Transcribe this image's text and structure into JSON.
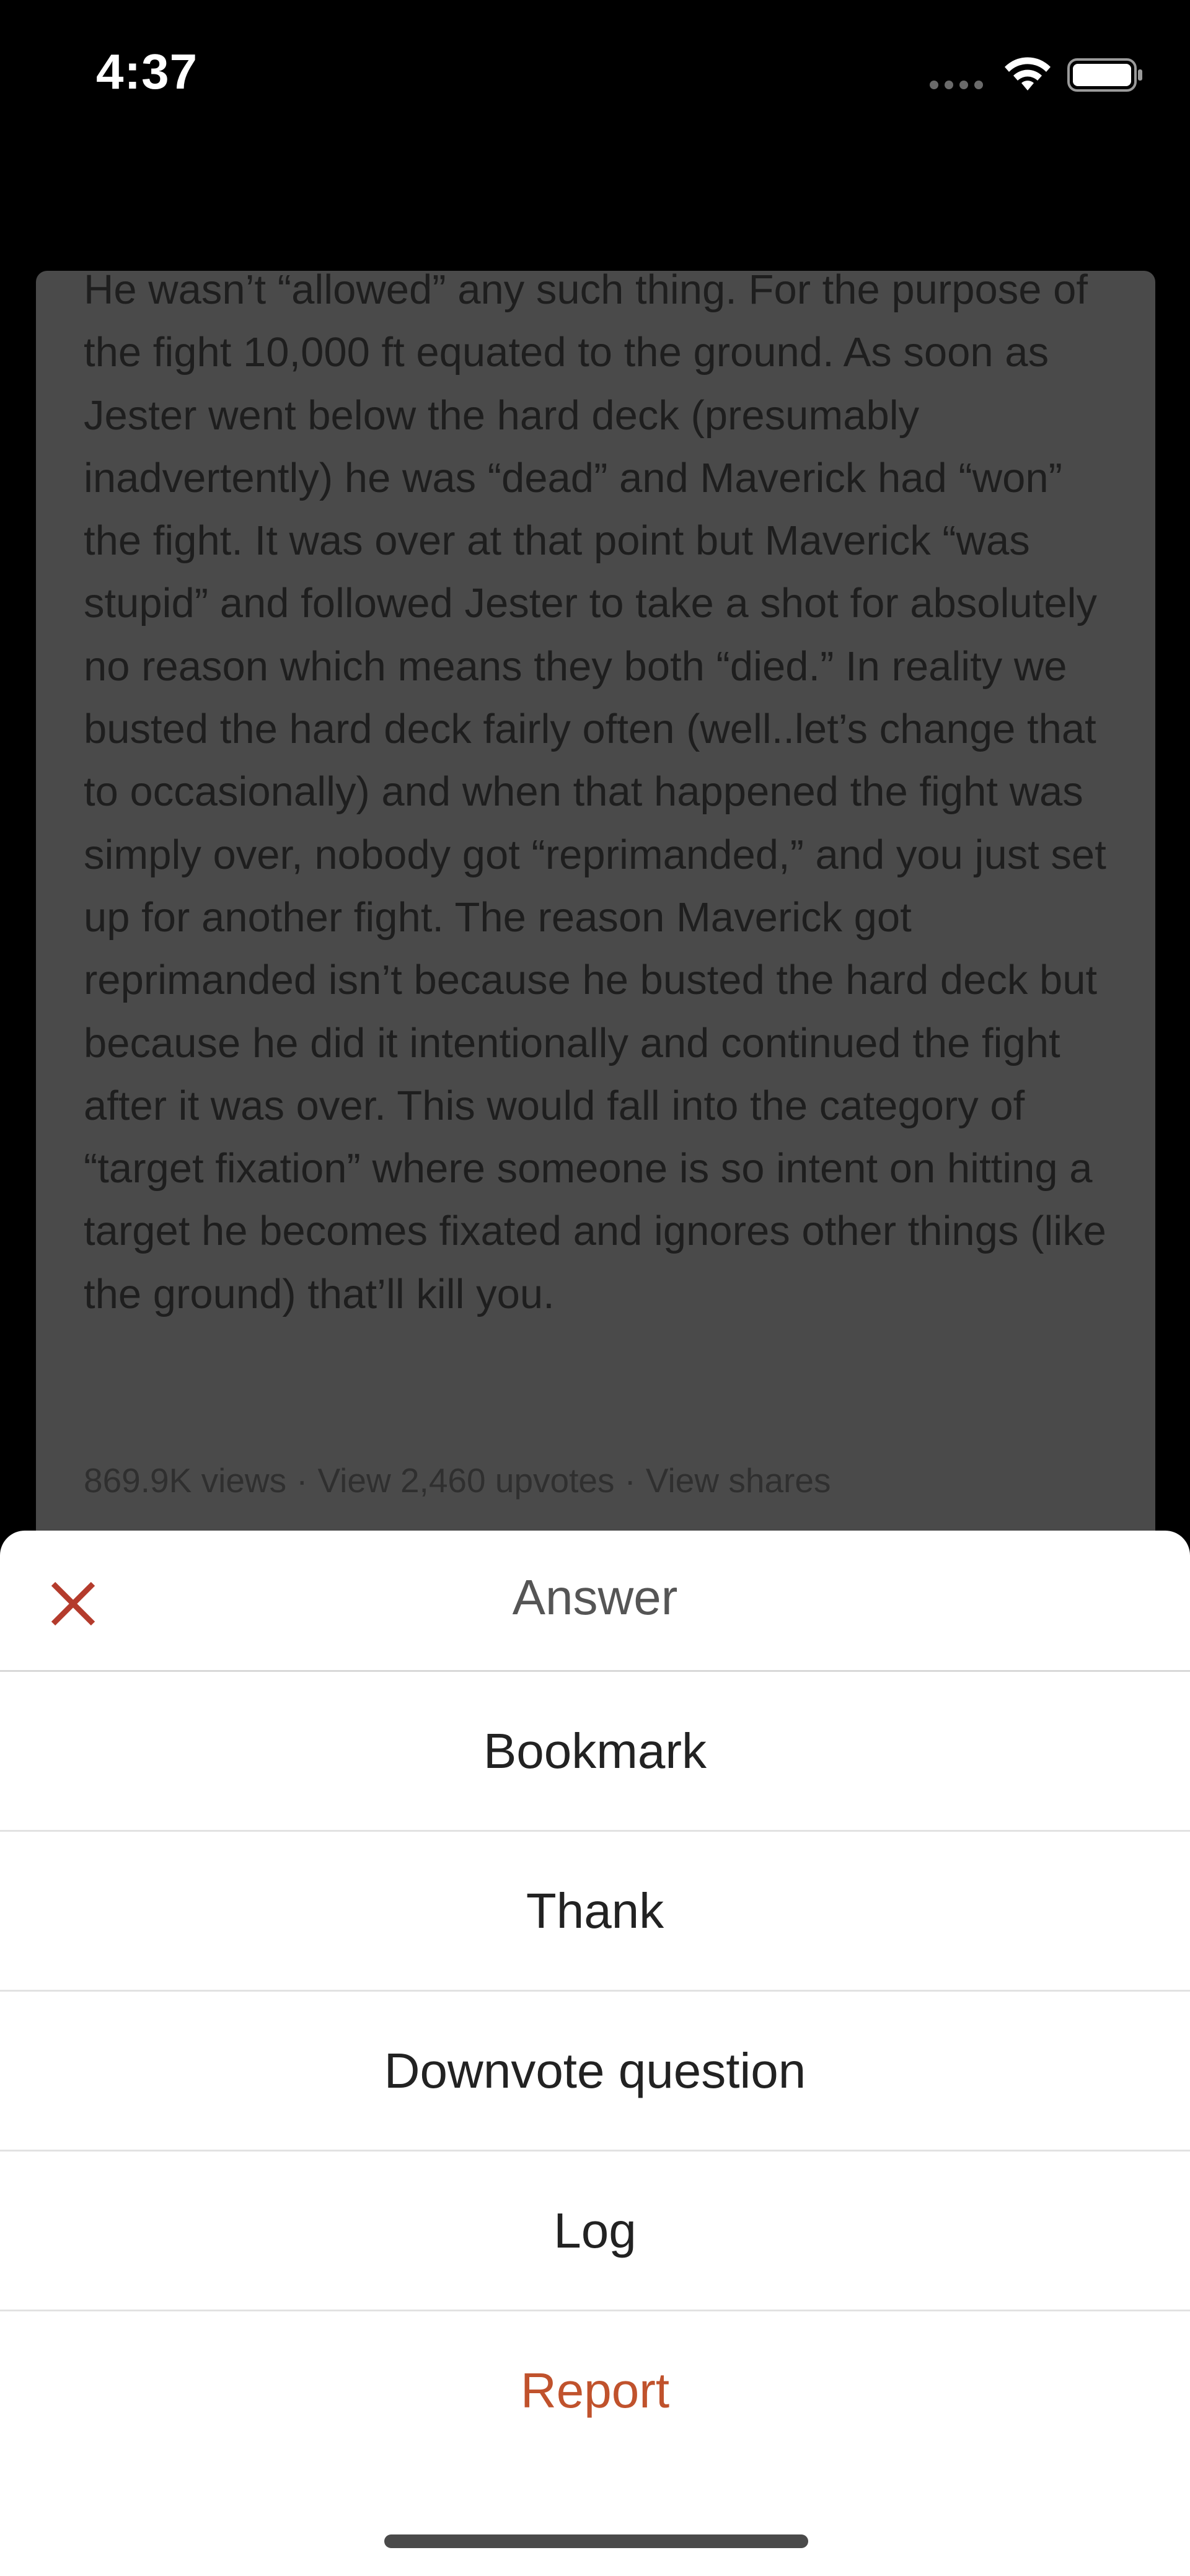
{
  "status_bar": {
    "time": "4:37"
  },
  "answer": {
    "body": "He wasn’t “allowed” any such thing. For the purpose of the fight 10,000 ft equated to the ground. As soon as Jester went below the hard deck (presumably inadvertently) he was “dead” and Maverick had “won” the fight. It was over at that point but Maverick “was stupid” and followed Jester to take a shot for absolutely no reason which means they both “died.” In reality we busted the hard deck fairly often (well..let’s change that to occasionally) and when that happened the fight was simply over, nobody got “reprimanded,” and you just set up for another fight. The reason Maverick got reprimanded isn’t because he busted the hard deck but because he did it intentionally and continued the fight after it was over. This would fall into the category of “target fixation” where someone is so intent on hitting a target he becomes fixated and ignores other things (like the ground) that’ll kill you.",
    "views": "869.9K views",
    "upvotes": "View 2,460 upvotes",
    "shares": "View shares",
    "separator": "·"
  },
  "sheet": {
    "title": "Answer",
    "actions": [
      {
        "label": "Bookmark"
      },
      {
        "label": "Thank"
      },
      {
        "label": "Downvote question"
      },
      {
        "label": "Log"
      },
      {
        "label": "Report"
      }
    ]
  },
  "colors": {
    "close_icon": "#b43b2c",
    "report": "#c0522c",
    "card_dimmed": "#4a4a4a"
  },
  "icons": {
    "close": "close-icon",
    "wifi": "wifi-icon",
    "battery": "battery-icon",
    "signal": "signal-icon"
  }
}
